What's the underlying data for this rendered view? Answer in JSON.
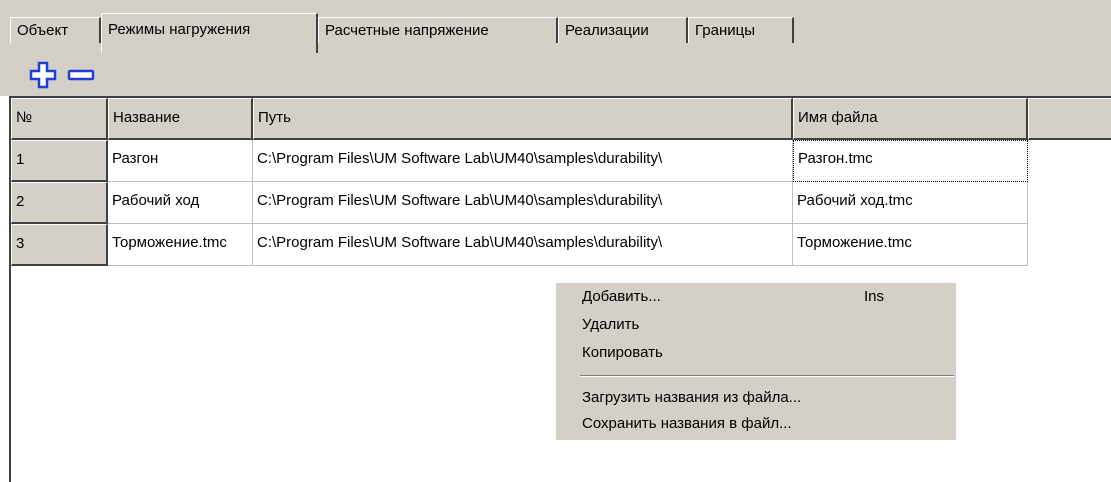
{
  "tabs": [
    {
      "label": "Объект",
      "active": false
    },
    {
      "label": "Режимы нагружения",
      "active": true
    },
    {
      "label": "Расчетные напряжение",
      "active": false
    },
    {
      "label": "Реализации",
      "active": false
    },
    {
      "label": "Границы",
      "active": false
    }
  ],
  "toolbar": {
    "add_icon": "plus-icon",
    "remove_icon": "minus-icon",
    "icon_color": "#1f3fd6"
  },
  "grid": {
    "columns": [
      "№",
      "Название",
      "Путь",
      "Имя файла"
    ],
    "rows": [
      {
        "num": "1",
        "name": "Разгон",
        "path": "C:\\Program Files\\UM Software Lab\\UM40\\samples\\durability\\",
        "file": "Разгон.tmc"
      },
      {
        "num": "2",
        "name": "Рабочий ход",
        "path": "C:\\Program Files\\UM Software Lab\\UM40\\samples\\durability\\",
        "file": "Рабочий ход.tmc"
      },
      {
        "num": "3",
        "name": "Торможение.tmc",
        "path": "C:\\Program Files\\UM Software Lab\\UM40\\samples\\durability\\",
        "file": "Торможение.tmc"
      }
    ]
  },
  "context_menu": {
    "items": [
      {
        "label": "Добавить...",
        "shortcut": "Ins"
      },
      {
        "label": "Удалить",
        "shortcut": ""
      },
      {
        "label": "Копировать",
        "shortcut": ""
      },
      {
        "label": "Загрузить названия из файла...",
        "shortcut": ""
      },
      {
        "label": "Сохранить названия в файл...",
        "shortcut": ""
      }
    ]
  }
}
